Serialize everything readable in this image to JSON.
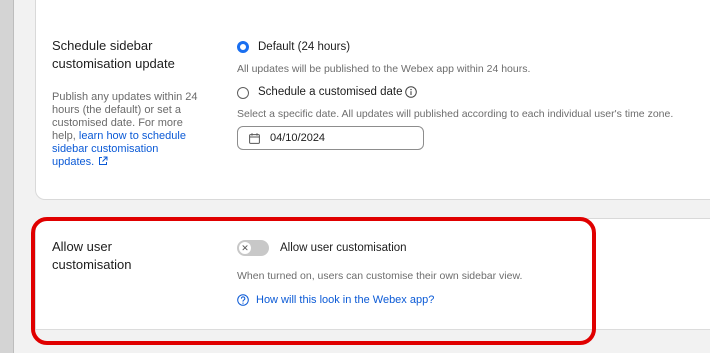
{
  "schedule": {
    "title": "Schedule sidebar customisation update",
    "desc_text": "Publish any updates within 24 hours (the default) or set a customised date. For more help,",
    "desc_link": "learn how to schedule sidebar customisation updates.",
    "option_default_label": "Default (24 hours)",
    "option_default_help": "All updates will be published to the Webex app within 24 hours.",
    "option_custom_label": "Schedule a customised date",
    "option_custom_help": "Select a specific date. All updates will published according to each individual user's time zone.",
    "date_value": "04/10/2024",
    "selected": "default"
  },
  "allow": {
    "title": "Allow user customisation",
    "toggle_label": "Allow user customisation",
    "toggle_state": "off",
    "help_text": "When turned on, users can customise their own sidebar view.",
    "help_link": "How will this look in the Webex app?"
  },
  "colors": {
    "accent": "#1a6ff0",
    "link": "#0b5ad6",
    "highlight": "#e00000"
  },
  "icons": [
    "info-icon",
    "calendar-icon",
    "external-link-icon",
    "close-x-icon",
    "help-circle-icon"
  ]
}
